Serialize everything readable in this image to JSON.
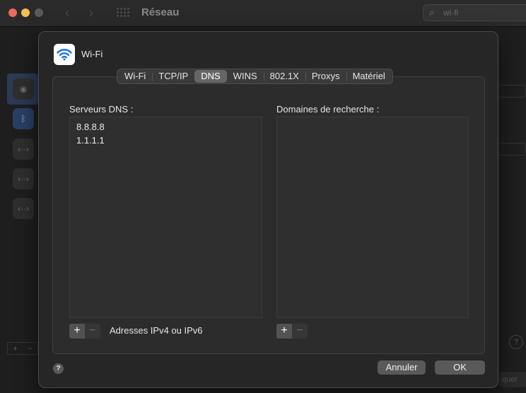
{
  "background_window": {
    "title": "Réseau",
    "search_query": "wi-fi",
    "partial_button_text": "quer"
  },
  "sheet": {
    "title": "Wi-Fi",
    "tabs": [
      {
        "label": "Wi-Fi",
        "active": false
      },
      {
        "label": "TCP/IP",
        "active": false
      },
      {
        "label": "DNS",
        "active": true
      },
      {
        "label": "WINS",
        "active": false
      },
      {
        "label": "802.1X",
        "active": false
      },
      {
        "label": "Proxys",
        "active": false
      },
      {
        "label": "Matériel",
        "active": false
      }
    ],
    "dns_servers": {
      "label": "Serveurs DNS :",
      "items": [
        "8.8.8.8",
        "1.1.1.1"
      ],
      "hint": "Adresses IPv4 ou IPv6"
    },
    "search_domains": {
      "label": "Domaines de recherche :",
      "items": []
    },
    "add_symbol": "+",
    "remove_symbol": "−",
    "help_symbol": "?",
    "cancel_label": "Annuler",
    "ok_label": "OK"
  },
  "colors": {
    "wifi_icon": "#1a73e8",
    "active_tab": "#666666",
    "sheet_bg": "#262626"
  }
}
